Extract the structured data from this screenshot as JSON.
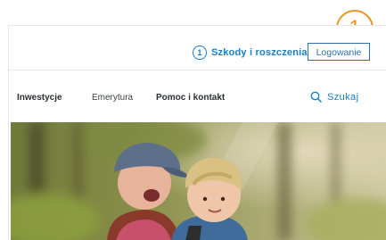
{
  "topbar": {
    "claims_number": "1",
    "claims_label": "Szkody i roszczenia",
    "login_label": "Logowanie"
  },
  "callout": {
    "number": "1",
    "color": "#e8962a"
  },
  "nav": {
    "items": [
      {
        "label": "Inwestycje"
      },
      {
        "label": "Emerytura"
      },
      {
        "label": "Pomoc i kontakt"
      }
    ],
    "search_label": "Szukaj"
  },
  "colors": {
    "accent": "#1a7fc1",
    "login_border": "#2f6fb0"
  },
  "icons": {
    "search": "search-icon"
  }
}
